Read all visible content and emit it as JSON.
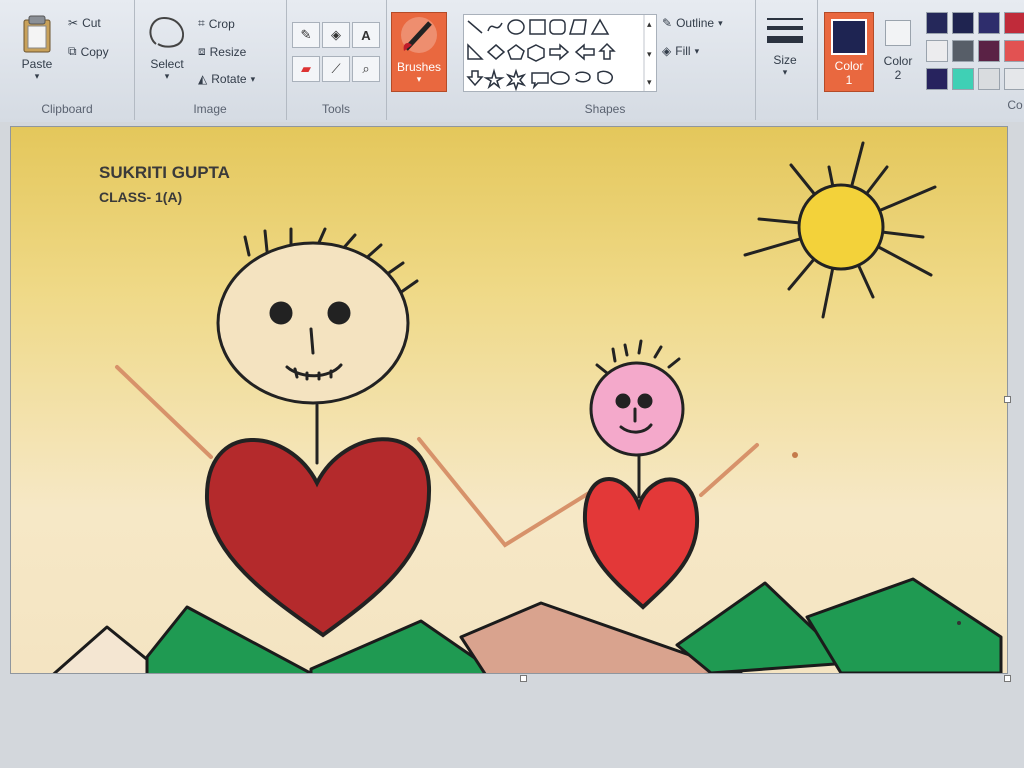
{
  "ribbon": {
    "clipboard": {
      "paste": "Paste",
      "cut": "Cut",
      "copy": "Copy",
      "label": "Clipboard"
    },
    "image": {
      "select": "Select",
      "crop": "Crop",
      "resize": "Resize",
      "rotate": "Rotate",
      "label": "Image"
    },
    "tools": {
      "label": "Tools",
      "text_tool": "A"
    },
    "brushes": {
      "label": "Brushes"
    },
    "shapes": {
      "label": "Shapes",
      "outline": "Outline",
      "fill": "Fill"
    },
    "size": {
      "label": "Size"
    },
    "color1": {
      "label": "Color",
      "num": "1",
      "color": "#1e2452"
    },
    "color2": {
      "label": "Color",
      "num": "2",
      "color": "#f2f3f5"
    },
    "colors_label": "Co",
    "palette": [
      "#25285a",
      "#1f2450",
      "#2e2d6c",
      "#c02b3a",
      "#ececee",
      "#575e68",
      "#5a2245",
      "#e25252",
      "#27235e",
      "#3fd0b5",
      "#d9dcdf",
      "#e5e7ea"
    ]
  },
  "drawing": {
    "name": "SUKRITI GUPTA",
    "class": "CLASS- 1(A)",
    "colors": {
      "big_heart": "#b42a2c",
      "small_heart": "#e33838",
      "small_face": "#f4a9cb",
      "sun": "#f3d23a",
      "arms": "#d7926a",
      "mountain_green": "#1f9a52",
      "mountain_pink": "#d9a38e"
    }
  }
}
